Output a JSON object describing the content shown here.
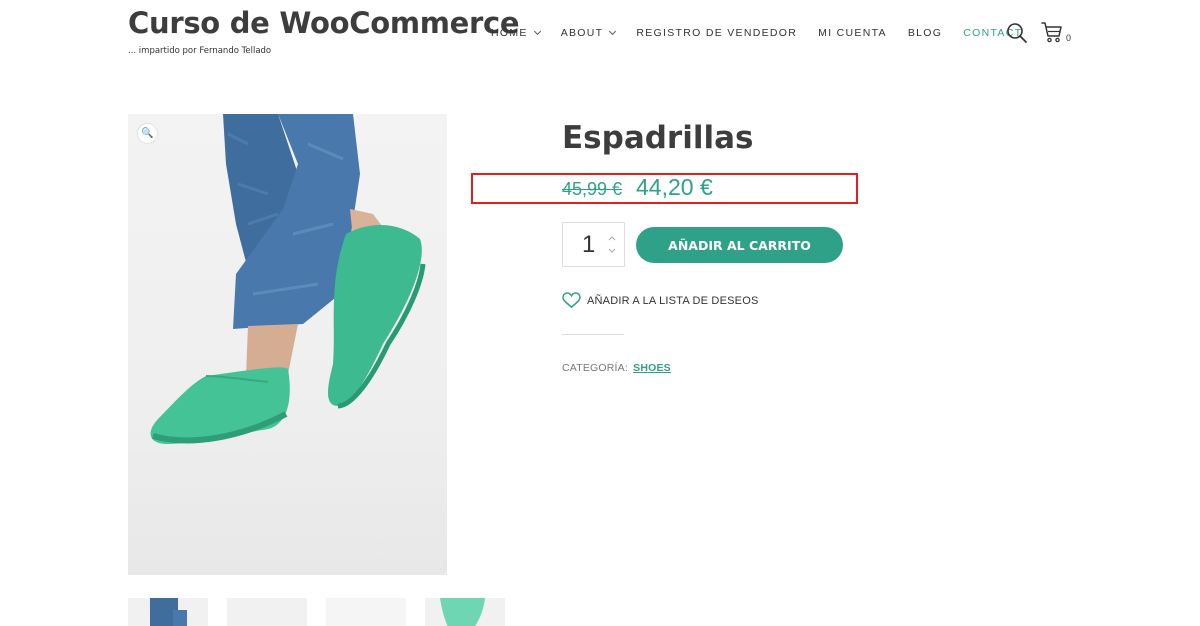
{
  "site": {
    "title": "Curso de WooCommerce",
    "tagline": "... impartido por Fernando Tellado"
  },
  "nav": {
    "items": [
      {
        "label": "HOME",
        "has_dropdown": true
      },
      {
        "label": "ABOUT",
        "has_dropdown": true
      },
      {
        "label": "REGISTRO DE VENDEDOR",
        "has_dropdown": false
      },
      {
        "label": "MI CUENTA",
        "has_dropdown": false
      },
      {
        "label": "BLOG",
        "has_dropdown": false
      },
      {
        "label": "CONTACT",
        "has_dropdown": false,
        "active": true
      }
    ],
    "search_icon": "search-icon",
    "cart_icon": "cart-icon",
    "cart_count": "0"
  },
  "product": {
    "title": "Espadrillas",
    "price_old": "45,99 €",
    "price_new": "44,20 €",
    "quantity": "1",
    "add_to_cart_label": "AÑADIR AL CARRITO",
    "wishlist_label": "AÑADIR A LA LISTA DE DESEOS",
    "category_label": "CATEGORÍA:",
    "category_value": "SHOES",
    "zoom_icon": "magnifier-icon"
  },
  "colors": {
    "accent": "#2fa188",
    "highlight": "#e02020",
    "text": "#333333"
  }
}
